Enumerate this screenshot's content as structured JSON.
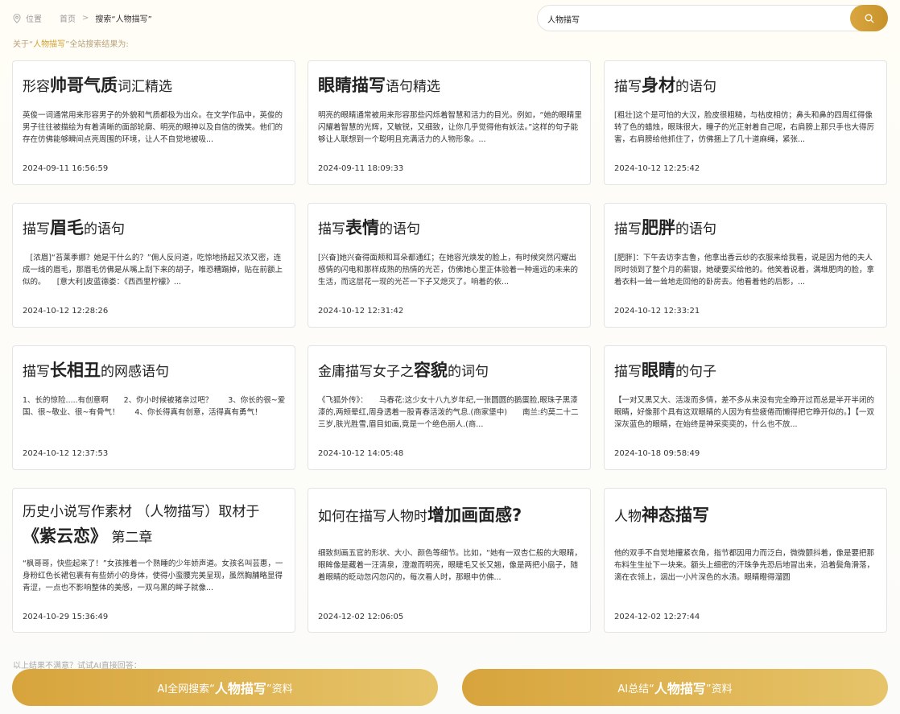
{
  "breadcrumb": {
    "label": "位置",
    "home": "首页",
    "separator": ">",
    "current": "搜索“人物描写”"
  },
  "search": {
    "value": "人物描写",
    "button_icon": "search-icon"
  },
  "result_note": {
    "prefix": "关于“",
    "keyword": "人物描写",
    "suffix": "”全站搜索结果为:"
  },
  "cards": [
    {
      "title_pre": "形容",
      "title_bold": "帅哥气质",
      "title_post": "词汇精选",
      "excerpt": "英俊一词通常用来形容男子的外貌和气质都极为出众。在文学作品中，英俊的男子往往被描绘为有着清晰的面部轮廓、明亮的眼神以及自信的微笑。他们的存在仿佛能够瞬间点亮周围的环境，让人不自觉地被吸...",
      "date": "2024-09-11 16:56:59"
    },
    {
      "title_pre": "",
      "title_bold": "眼睛描写",
      "title_post": "语句精选",
      "excerpt": "明亮的眼睛通常被用来形容那些闪烁着智慧和活力的目光。例如，“她的眼睛里闪耀着智慧的光辉，又敏锐，又细致，让你几乎觉得他有妖法。”这样的句子能够让人联想到一个聪明且充满活力的人物形象。...",
      "date": "2024-09-11 18:09:33"
    },
    {
      "title_pre": "描写",
      "title_bold": "身材",
      "title_post": "的语句",
      "excerpt": "[粗壮]这个是可怕的大汉，脸皮很粗糙，与枯皮相仿；鼻头和鼻的四周红得像转了色的蜡烛，眼珠很大，瞳子的光正射着自己呢，右肩膀上那只手也大得厉害，右肩膀给他抓住了，仿佛捆上了几十道麻绳，紧张...",
      "date": "2024-10-12 12:25:42"
    },
    {
      "title_pre": "描写",
      "title_bold": "眉毛",
      "title_post": "的语句",
      "excerpt": "　[浓眉]“苔莱季娜？她是干什么的？”佣人反问道，吃惊地扬起又浓又密，连成一线的眉毛，那眉毛仿佛是从嘴上刮下来的胡子，唯恐糟蹋掉，贴在前额上似的。　　[意大利]皮蓝德娄：《西西里柠檬》...",
      "date": "2024-10-12 12:28:26"
    },
    {
      "title_pre": "描写",
      "title_bold": "表情",
      "title_post": "的语句",
      "excerpt": "[兴奋]她兴奋得面颊和耳朵都通红；在她容光焕发的脸上，有时候突然闪耀出感情的闪电和那样成熟的热情的光芒，仿佛她心里正体验着一种遥远的未来的生活，而这层花一现的光芒一下子又熄灭了。响着的依...",
      "date": "2024-10-12 12:31:42"
    },
    {
      "title_pre": "描写",
      "title_bold": "肥胖",
      "title_post": "的语句",
      "excerpt": "[肥胖]：下午去访李古鲁，他拿出香云纱的衣服来给我看，说是因为他的夫人同时领到了整个月的薪银，她硬要买给他的。他笑着说着，满堆肥肉的脸，拿着衣料一耸一耸地走回他的卧房去。他看着他的后影，...",
      "date": "2024-10-12 12:33:21"
    },
    {
      "title_pre": "描写",
      "title_bold": "长相丑",
      "title_post": "的网感语句",
      "excerpt": "1、长的惊险.....有创意啊　　2、你小时候被猪亲过吧？　　3、你长的很~爱国、很~敬业、很~有骨气！　　4、你长得真有创意，活得真有勇气！",
      "date": "2024-10-12 12:37:53"
    },
    {
      "title_pre": "金庸描写女子之",
      "title_bold": "容貌",
      "title_post": "的词句",
      "excerpt": "《飞狐外传》：　　马春花:这少女十八九岁年纪,一张圆圆的鹅蛋脸,眼珠子黑漆漆的,两颊晕红,周身透着一股青春活泼的气息.(商家堡中)　　南兰:约莫二十二三岁,肤光胜雪,眉目如画,竟是一个绝色丽人.(商...",
      "date": "2024-10-12 14:05:48"
    },
    {
      "title_pre": "描写",
      "title_bold": "眼睛",
      "title_post": "的句子",
      "excerpt": "【一对又黑又大、活泼而多情，差不多从来没有完全睁开过而总是半开半闭的眼睛，好像那个具有这双眼睛的人因为有些疲倦而懒得把它睁开似的。】【一双深灰蓝色的眼睛，在始终是神采奕奕的，什么也不放...",
      "date": "2024-10-18 09:58:49"
    },
    {
      "title_pre": "历史小说写作素材 （人物描写）取材于",
      "title_bold": "《紫云恋》",
      "title_post": "第二章",
      "excerpt": "“枫哥哥，快些起来了！”女孩推着一个熟睡的少年娇声道。女孩名叫芸惠，一身粉红色长裙包裹有有些娇小的身体，使得小蛮腰完美呈现，虽然胸脯略显得青涩，一点也不影响整体的美感，一双乌黑的眸子就像...",
      "date": "2024-10-29 15:36:49"
    },
    {
      "title_pre": "如何在描写人物时",
      "title_bold": "增加画面感?",
      "title_post": "",
      "excerpt": "细致刻画五官的形状、大小、颜色等细节。比如，“她有一双杏仁般的大眼睛，眼眸像是藏着一汪清泉，澄澈而明亮，眼睫毛又长又翘，像是两把小扇子，随着眼睛的眨动忽闪忽闪的，每次看人时，那眼中仿佛...",
      "date": "2024-12-02 12:06:05"
    },
    {
      "title_pre": "人物",
      "title_bold": "神态描写",
      "title_post": "",
      "excerpt": "他的双手不自觉地攥紧衣角，指节都因用力而泛白，微微颤抖着，像是要把那布料生生扯下一块来。额头上细密的汗珠争先恐后地冒出来，沿着鬓角滑落，滴在衣领上，洇出一小片深色的水渍。眼睛瞪得溜圆",
      "date": "2024-12-02 12:27:44"
    }
  ],
  "ask_note": "以上结果不满意？试试AI直接回答：",
  "ai_buttons": [
    {
      "pre": "AI全网搜索“",
      "bold": "人物描写",
      "post": "”资料"
    },
    {
      "pre": "AI总结“",
      "bold": "人物描写",
      "post": "”资料"
    }
  ],
  "colors": {
    "accent": "#d2a02e",
    "button_gradient_start": "#d7a43c",
    "button_gradient_end": "#e6c46a"
  }
}
